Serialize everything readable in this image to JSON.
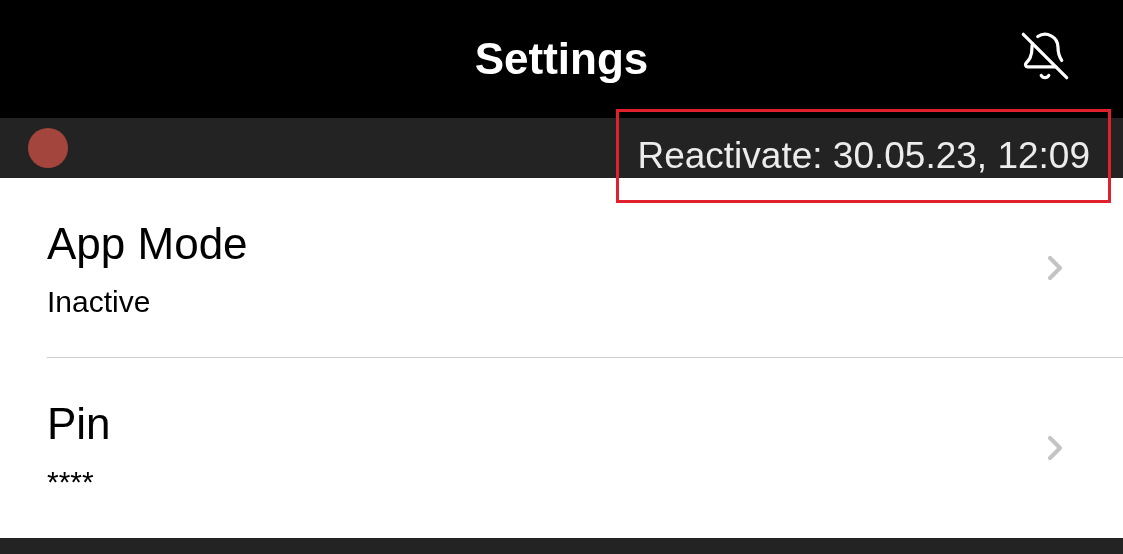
{
  "header": {
    "title": "Settings",
    "muted": true
  },
  "status": {
    "color": "#a3453c",
    "text": "Reactivate: 30.05.23, 12:09",
    "highlighted": true
  },
  "items": [
    {
      "title": "App Mode",
      "value": "Inactive"
    },
    {
      "title": "Pin",
      "value": "****"
    }
  ]
}
